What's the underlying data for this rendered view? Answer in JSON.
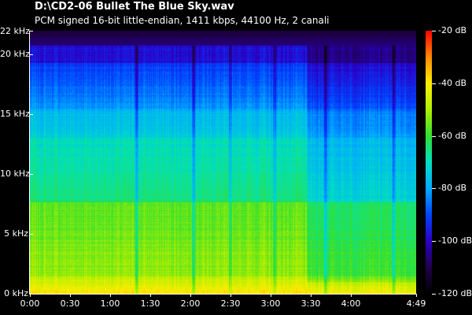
{
  "header": {
    "file_title": "D:\\CD2-06 Bullet The Blue Sky.wav",
    "format_info": "PCM signed 16-bit little-endian, 1411 kbps, 44100 Hz, 2 canali"
  },
  "chart_data": {
    "type": "heatmap",
    "title": "D:\\CD2-06 Bullet The Blue Sky.wav",
    "subtitle": "PCM signed 16-bit little-endian, 1411 kbps, 44100 Hz, 2 canali",
    "x_ticks": [
      "0:00",
      "0:30",
      "1:00",
      "1:30",
      "2:00",
      "2:30",
      "3:00",
      "3:30",
      "4:00",
      "4:49"
    ],
    "x_tick_seconds": [
      0,
      30,
      60,
      90,
      120,
      150,
      180,
      210,
      240,
      289
    ],
    "xlim": [
      0,
      289
    ],
    "y_ticks": [
      "0 kHz",
      "5 kHz",
      "10 kHz",
      "15 kHz",
      "20 kHz",
      "22 kHz"
    ],
    "y_tick_khz": [
      0,
      5,
      10,
      15,
      20,
      22
    ],
    "ylim": [
      0,
      22
    ],
    "colorbar_ticks": [
      "-20 dB",
      "-40 dB",
      "-60 dB",
      "-80 dB",
      "-100 dB",
      "-120 dB"
    ],
    "colorbar_db": [
      -20,
      -40,
      -60,
      -80,
      -100,
      -120
    ],
    "colorbar_range": [
      -120,
      -20
    ],
    "colormap": [
      "#000000",
      "#20004a",
      "#2a00c8",
      "#0044ff",
      "#00aaff",
      "#00e0c0",
      "#30e030",
      "#b0ee00",
      "#ffee00",
      "#ff8800",
      "#ff0000"
    ]
  }
}
